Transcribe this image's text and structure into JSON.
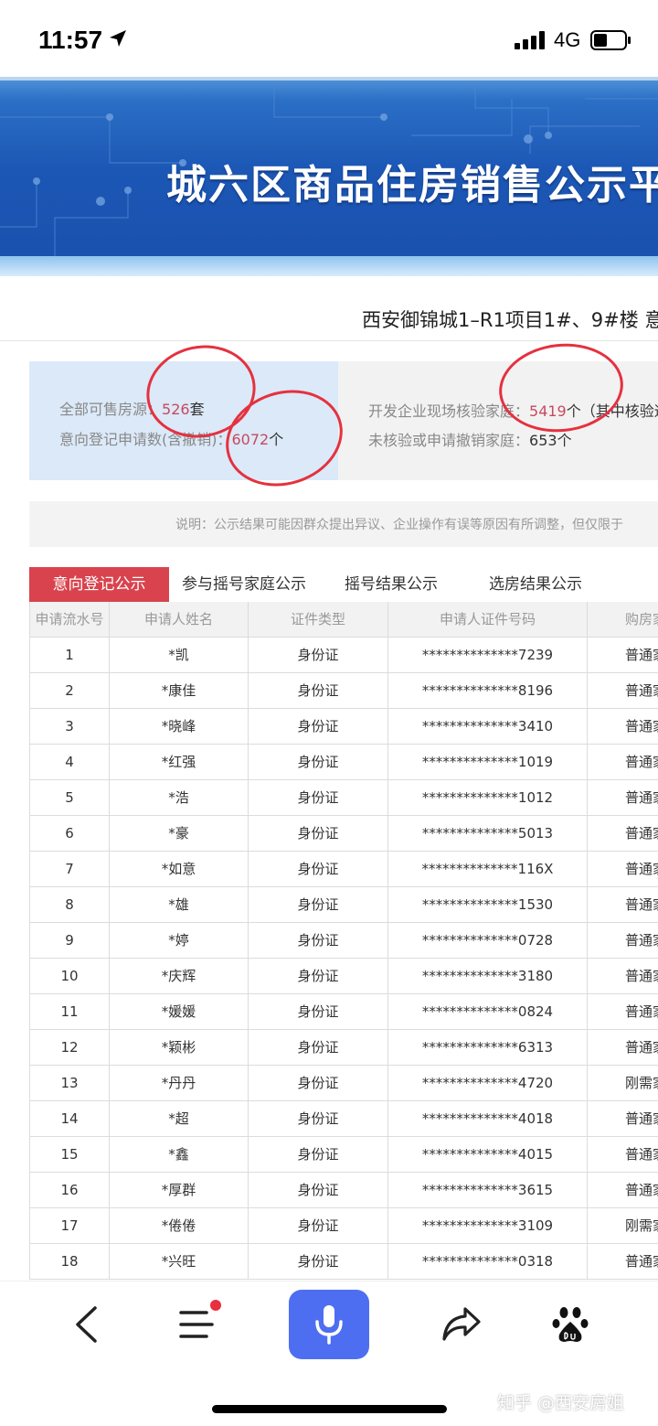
{
  "status_bar": {
    "time": "11:57",
    "network": "4G"
  },
  "banner": {
    "title": "城六区商品住房销售公示平"
  },
  "project": {
    "title": "西安御锦城1–R1项目1#、9#楼 意"
  },
  "summary": {
    "total_label": "全部可售房源：",
    "total_value": "526",
    "total_unit": "套",
    "applications_label": "意向登记申请数(含撤销)：",
    "applications_value": "6072",
    "applications_unit": "个",
    "verified_label": "开发企业现场核验家庭：",
    "verified_value": "5419",
    "verified_unit": "个（其中核验通",
    "unverified_label": "未核验或申请撤销家庭：",
    "unverified_value": "653",
    "unverified_unit": "个"
  },
  "notice": {
    "text": "说明：公示结果可能因群众提出异议、企业操作有误等原因有所调整，但仅限于"
  },
  "tabs": [
    {
      "label": "意向登记公示",
      "active": true
    },
    {
      "label": "参与摇号家庭公示",
      "active": false
    },
    {
      "label": "摇号结果公示",
      "active": false
    },
    {
      "label": "选房结果公示",
      "active": false
    }
  ],
  "table": {
    "headers": [
      "申请流水号",
      "申请人姓名",
      "证件类型",
      "申请人证件号码",
      "购房家庭"
    ],
    "rows": [
      [
        "1",
        "*凯",
        "身份证",
        "**************7239",
        "普通家"
      ],
      [
        "2",
        "*康佳",
        "身份证",
        "**************8196",
        "普通家"
      ],
      [
        "3",
        "*晓峰",
        "身份证",
        "**************3410",
        "普通家"
      ],
      [
        "4",
        "*红强",
        "身份证",
        "**************1019",
        "普通家"
      ],
      [
        "5",
        "*浩",
        "身份证",
        "**************1012",
        "普通家"
      ],
      [
        "6",
        "*豪",
        "身份证",
        "**************5013",
        "普通家"
      ],
      [
        "7",
        "*如意",
        "身份证",
        "**************116X",
        "普通家"
      ],
      [
        "8",
        "*雄",
        "身份证",
        "**************1530",
        "普通家"
      ],
      [
        "9",
        "*婷",
        "身份证",
        "**************0728",
        "普通家"
      ],
      [
        "10",
        "*庆辉",
        "身份证",
        "**************3180",
        "普通家"
      ],
      [
        "11",
        "*媛媛",
        "身份证",
        "**************0824",
        "普通家"
      ],
      [
        "12",
        "*颖彬",
        "身份证",
        "**************6313",
        "普通家"
      ],
      [
        "13",
        "*丹丹",
        "身份证",
        "**************4720",
        "刚需家"
      ],
      [
        "14",
        "*超",
        "身份证",
        "**************4018",
        "普通家"
      ],
      [
        "15",
        "*鑫",
        "身份证",
        "**************4015",
        "普通家"
      ],
      [
        "16",
        "*厚群",
        "身份证",
        "**************3615",
        "普通家"
      ],
      [
        "17",
        "*倦倦",
        "身份证",
        "**************3109",
        "刚需家"
      ],
      [
        "18",
        "*兴旺",
        "身份证",
        "**************0318",
        "普通家"
      ]
    ]
  },
  "toolbar": {
    "back_icon": "back-arrow-icon",
    "menu_icon": "menu-icon",
    "mic_icon": "microphone-icon",
    "share_icon": "share-icon",
    "baidu_icon": "baidu-paw-icon",
    "watermark": "知乎 @西安房姐"
  },
  "colors": {
    "banner_blue": "#1c57b5",
    "active_tab": "#d9434e",
    "highlight_number": "#c8495f",
    "annotation_red": "#e5313f",
    "mic_button": "#4e6ef2"
  }
}
